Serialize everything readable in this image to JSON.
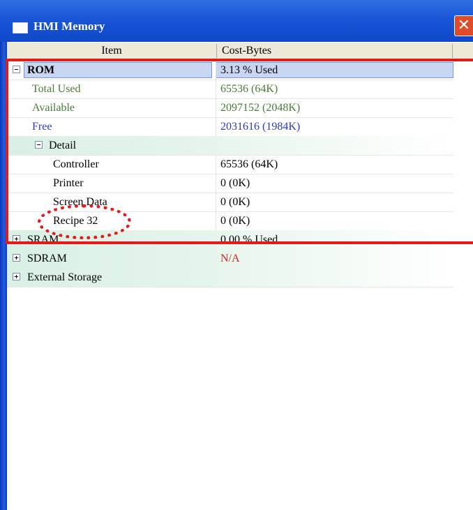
{
  "window": {
    "title": "HMI Memory",
    "close_glyph": "✕"
  },
  "columns": {
    "item": "Item",
    "cost": "Cost-Bytes"
  },
  "rows": [
    {
      "item": "ROM",
      "cost": "3.13 % Used"
    },
    {
      "item": "Total Used",
      "cost": "65536 (64K)"
    },
    {
      "item": "Available",
      "cost": "2097152 (2048K)"
    },
    {
      "item": "Free",
      "cost": "2031616 (1984K)"
    },
    {
      "item": "Detail",
      "cost": ""
    },
    {
      "item": "Controller",
      "cost": "65536 (64K)"
    },
    {
      "item": "Printer",
      "cost": "0 (0K)"
    },
    {
      "item": "Screen Data",
      "cost": "0 (0K)"
    },
    {
      "item": "Recipe 32",
      "cost": "0 (0K)"
    },
    {
      "item": "SRAM",
      "cost": "0.00 % Used"
    },
    {
      "item": "SDRAM",
      "cost": "N/A"
    },
    {
      "item": "External Storage",
      "cost": ""
    }
  ],
  "colors": {
    "title_bar": "#1a55d8",
    "highlight_box": "#e41a1a",
    "green_text": "#4a7a3a",
    "blue_text": "#2a3ab8",
    "red_text": "#d02020"
  }
}
